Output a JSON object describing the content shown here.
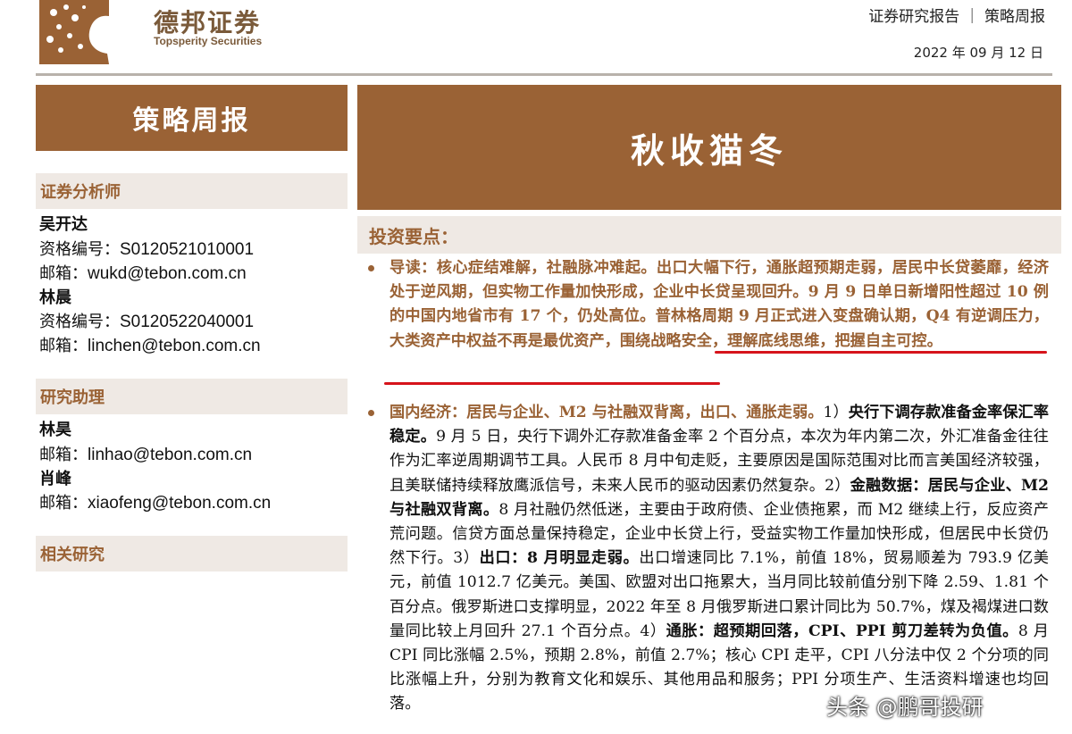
{
  "header": {
    "brand_cn": "德邦证券",
    "brand_en": "Topsperity Securities",
    "report_type": "证券研究报告 ｜ 策略周报",
    "date": "2022 年 09 月 12 日"
  },
  "sidebar": {
    "column_title": "策略周报",
    "analysts_heading": "证券分析师",
    "analysts": [
      {
        "name": "吴开达",
        "cert_label": "资格编号：",
        "cert": "S0120521010001",
        "email_label": "邮箱：",
        "email": "wukd@tebon.com.cn"
      },
      {
        "name": "林晨",
        "cert_label": "资格编号：",
        "cert": "S0120522040001",
        "email_label": "邮箱：",
        "email": "linchen@tebon.com.cn"
      }
    ],
    "assistants_heading": "研究助理",
    "assistants": [
      {
        "name": "林昊",
        "email_label": "邮箱：",
        "email": "linhao@tebon.com.cn"
      },
      {
        "name": "肖峰",
        "email_label": "邮箱：",
        "email": "xiaofeng@tebon.com.cn"
      }
    ],
    "related_heading": "相关研究"
  },
  "main": {
    "title": "秋收猫冬",
    "highlights_heading": "投资要点：",
    "para1": "导读：核心症结难解，社融脉冲难起。出口大幅下行，通胀超预期走弱，居民中长贷萎靡，经济处于逆风期，但实物工作量加快形成，企业中长贷呈现回升。9 月 9 日单日新增阳性超过 10 例的中国内地省市有 17 个，仍处高位。普林格周期 9 月正式进入变盘确认期，Q4 有逆调压力，大类资产中权益不再是最优资产，围绕战略安全，理解底线思维，把握自主可控。",
    "para2": {
      "lead": "国内经济：居民与企业、M2 与社融双背离，出口、通胀走弱。",
      "s1": "1）",
      "b1": "央行下调存款准备金率保汇率稳定。",
      "s2": "9 月 5 日，央行下调外汇存款准备金率 2 个百分点，本次为年内第二次，外汇准备金往往作为汇率逆周期调节工具。人民币 8 月中旬走贬，主要原因是国际范围对比而言美国经济较强，且美联储持续释放鹰派信号，未来人民币的驱动因素仍然复杂。2）",
      "b2": "金融数据：居民与企业、M2 与社融双背离。",
      "s3": "8 月社融仍然低迷，主要由于政府债、企业债拖累，而 M2 继续上行，反应资产荒问题。信贷方面总量保持稳定，企业中长贷上行，受益实物工作量加快形成，但居民中长贷仍然下行。3）",
      "b3": "出口：8 月明显走弱。",
      "s4": "出口增速同比 7.1%，前值 18%，贸易顺差为 793.9 亿美元，前值 1012.7 亿美元。美国、欧盟对出口拖累大，当月同比较前值分别下降 2.59、1.81 个百分点。俄罗斯进口支撑明显，2022 年至 8 月俄罗斯进口累计同比为 50.7%，煤及褐煤进口数量同比较上月回升 27.1 个百分点。4）",
      "b4": "通胀：超预期回落，CPI、PPI 剪刀差转为负值。",
      "s5": "8 月 CPI 同比涨幅 2.5%，预期 2.8%，前值 2.7%；核心 CPI 走平，CPI 八分法中仅 2 个分项的同比涨幅上升，分别为教育文化和娱乐、其他用品和服务；PPI 分项生产、生活资料增速也均回落。"
    }
  },
  "watermark": "头条 @鹏哥投研",
  "colors": {
    "brand_brown": "#9a6235",
    "band_bg": "#efe9e4",
    "underline_red": "#d6141b"
  }
}
